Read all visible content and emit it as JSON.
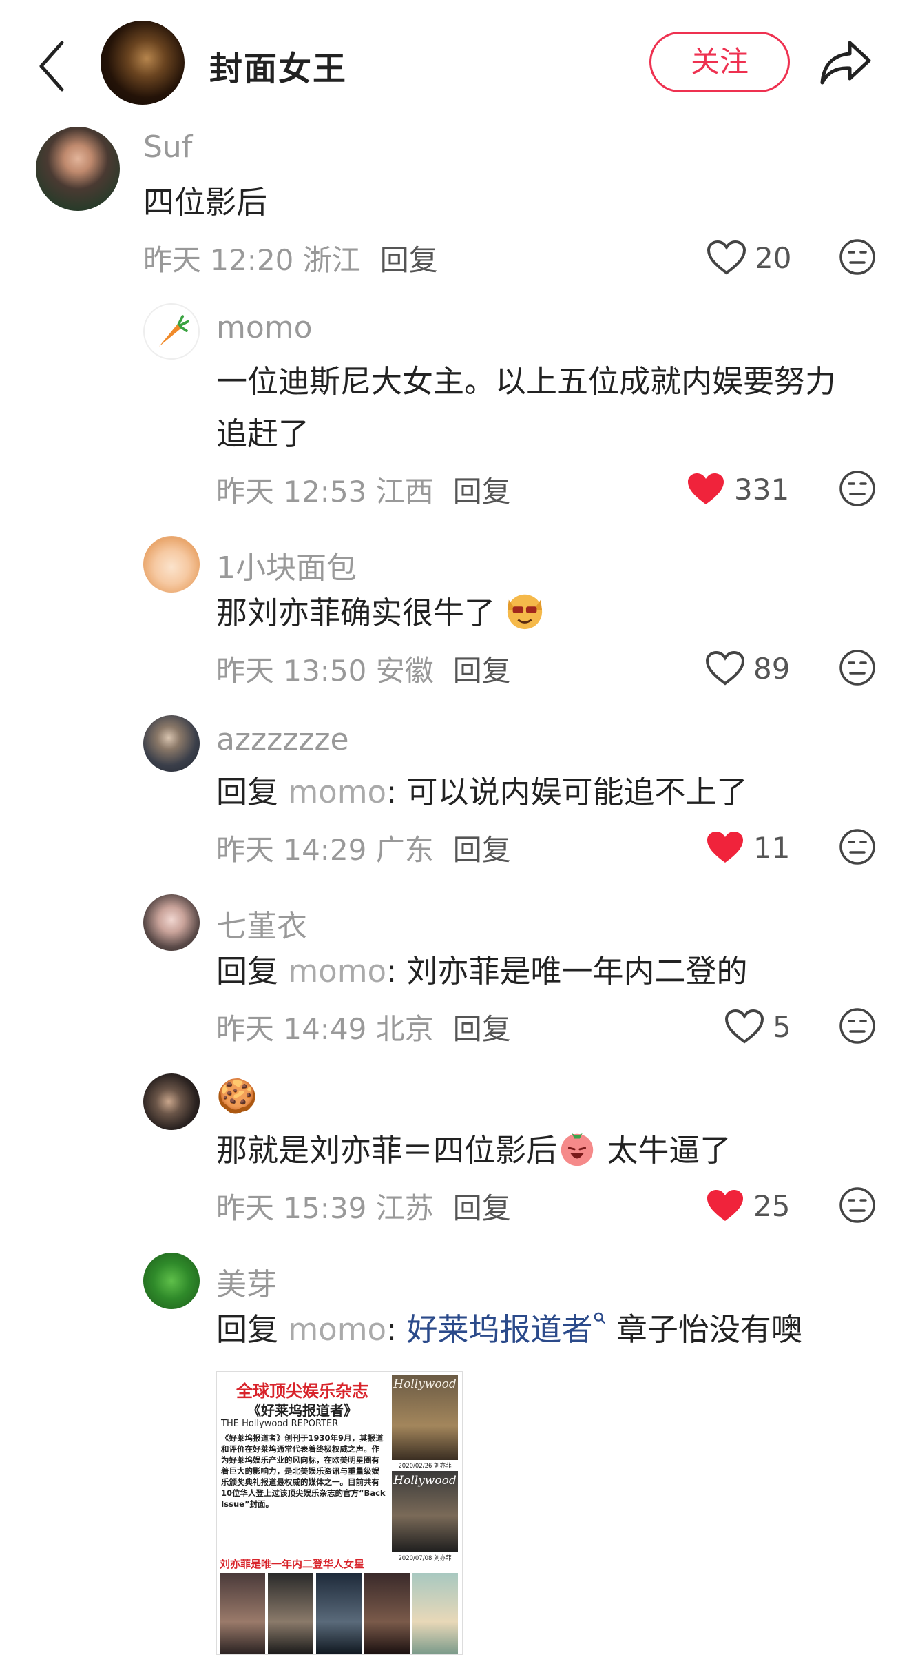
{
  "header": {
    "title": "封面女王",
    "follow_label": "关注"
  },
  "comments": [
    {
      "user": "Suf",
      "text": "四位影后",
      "time": "昨天 12:20 浙江",
      "reply": "回复",
      "likes": "20",
      "liked": false
    },
    {
      "user": "momo",
      "text_line1": "一位迪斯尼大女主。以上五位成就内娱要努力",
      "text_line2": "追赶了",
      "time": "昨天 12:53 江西",
      "reply": "回复",
      "likes": "331",
      "liked": true
    },
    {
      "user": "1小块面包",
      "text": "那刘亦菲确实很牛了",
      "time": "昨天 13:50 安徽",
      "reply": "回复",
      "likes": "89",
      "liked": false
    },
    {
      "user": "azzzzzze",
      "prefix": "回复",
      "mention": "momo",
      "text": ": 可以说内娱可能追不上了",
      "time": "昨天 14:29 广东",
      "reply": "回复",
      "likes": "11",
      "liked": true
    },
    {
      "user": "七堇衣",
      "prefix": "回复",
      "mention": "momo",
      "text": ": 刘亦菲是唯一年内二登的",
      "time": "昨天 14:49 北京",
      "reply": "回复",
      "likes": "5",
      "liked": false
    },
    {
      "user": "🍪",
      "text_a": "那就是刘亦菲＝四位影后",
      "text_b": " 太牛逼了",
      "time": "昨天 15:39 江苏",
      "reply": "回复",
      "likes": "25",
      "liked": true
    },
    {
      "user": "美芽",
      "prefix": "回复",
      "mention": "momo",
      "colon": ": ",
      "link": "好莱坞报道者",
      "text": " 章子怡没有噢"
    }
  ],
  "magazine": {
    "headline": "全球顶尖娱乐杂志",
    "name": "《好莱坞报道者》",
    "english": "THE Hollywood REPORTER",
    "body": "《好莱坞报道者》创刊于1930年9月，其报道和评价在好莱坞通常代表着终极权威之声。作为好莱坞娱乐产业的风向标，在欧美明星圈有着巨大的影响力，是北美娱乐资讯与重量级娱乐颁奖典礼报道最权威的媒体之一。目前共有10位华人登上过该顶尖娱乐杂志的官方“Back Issue”封面。",
    "highlight": "刘亦菲是唯一年内二登华人女星",
    "cover1_date": "2020/02/26 刘亦菲",
    "cover2_date": "2020/07/08 刘亦菲",
    "cover_logo": "Hollywood"
  },
  "colors": {
    "accent": "#ee3150",
    "like_red": "#f0233b"
  }
}
